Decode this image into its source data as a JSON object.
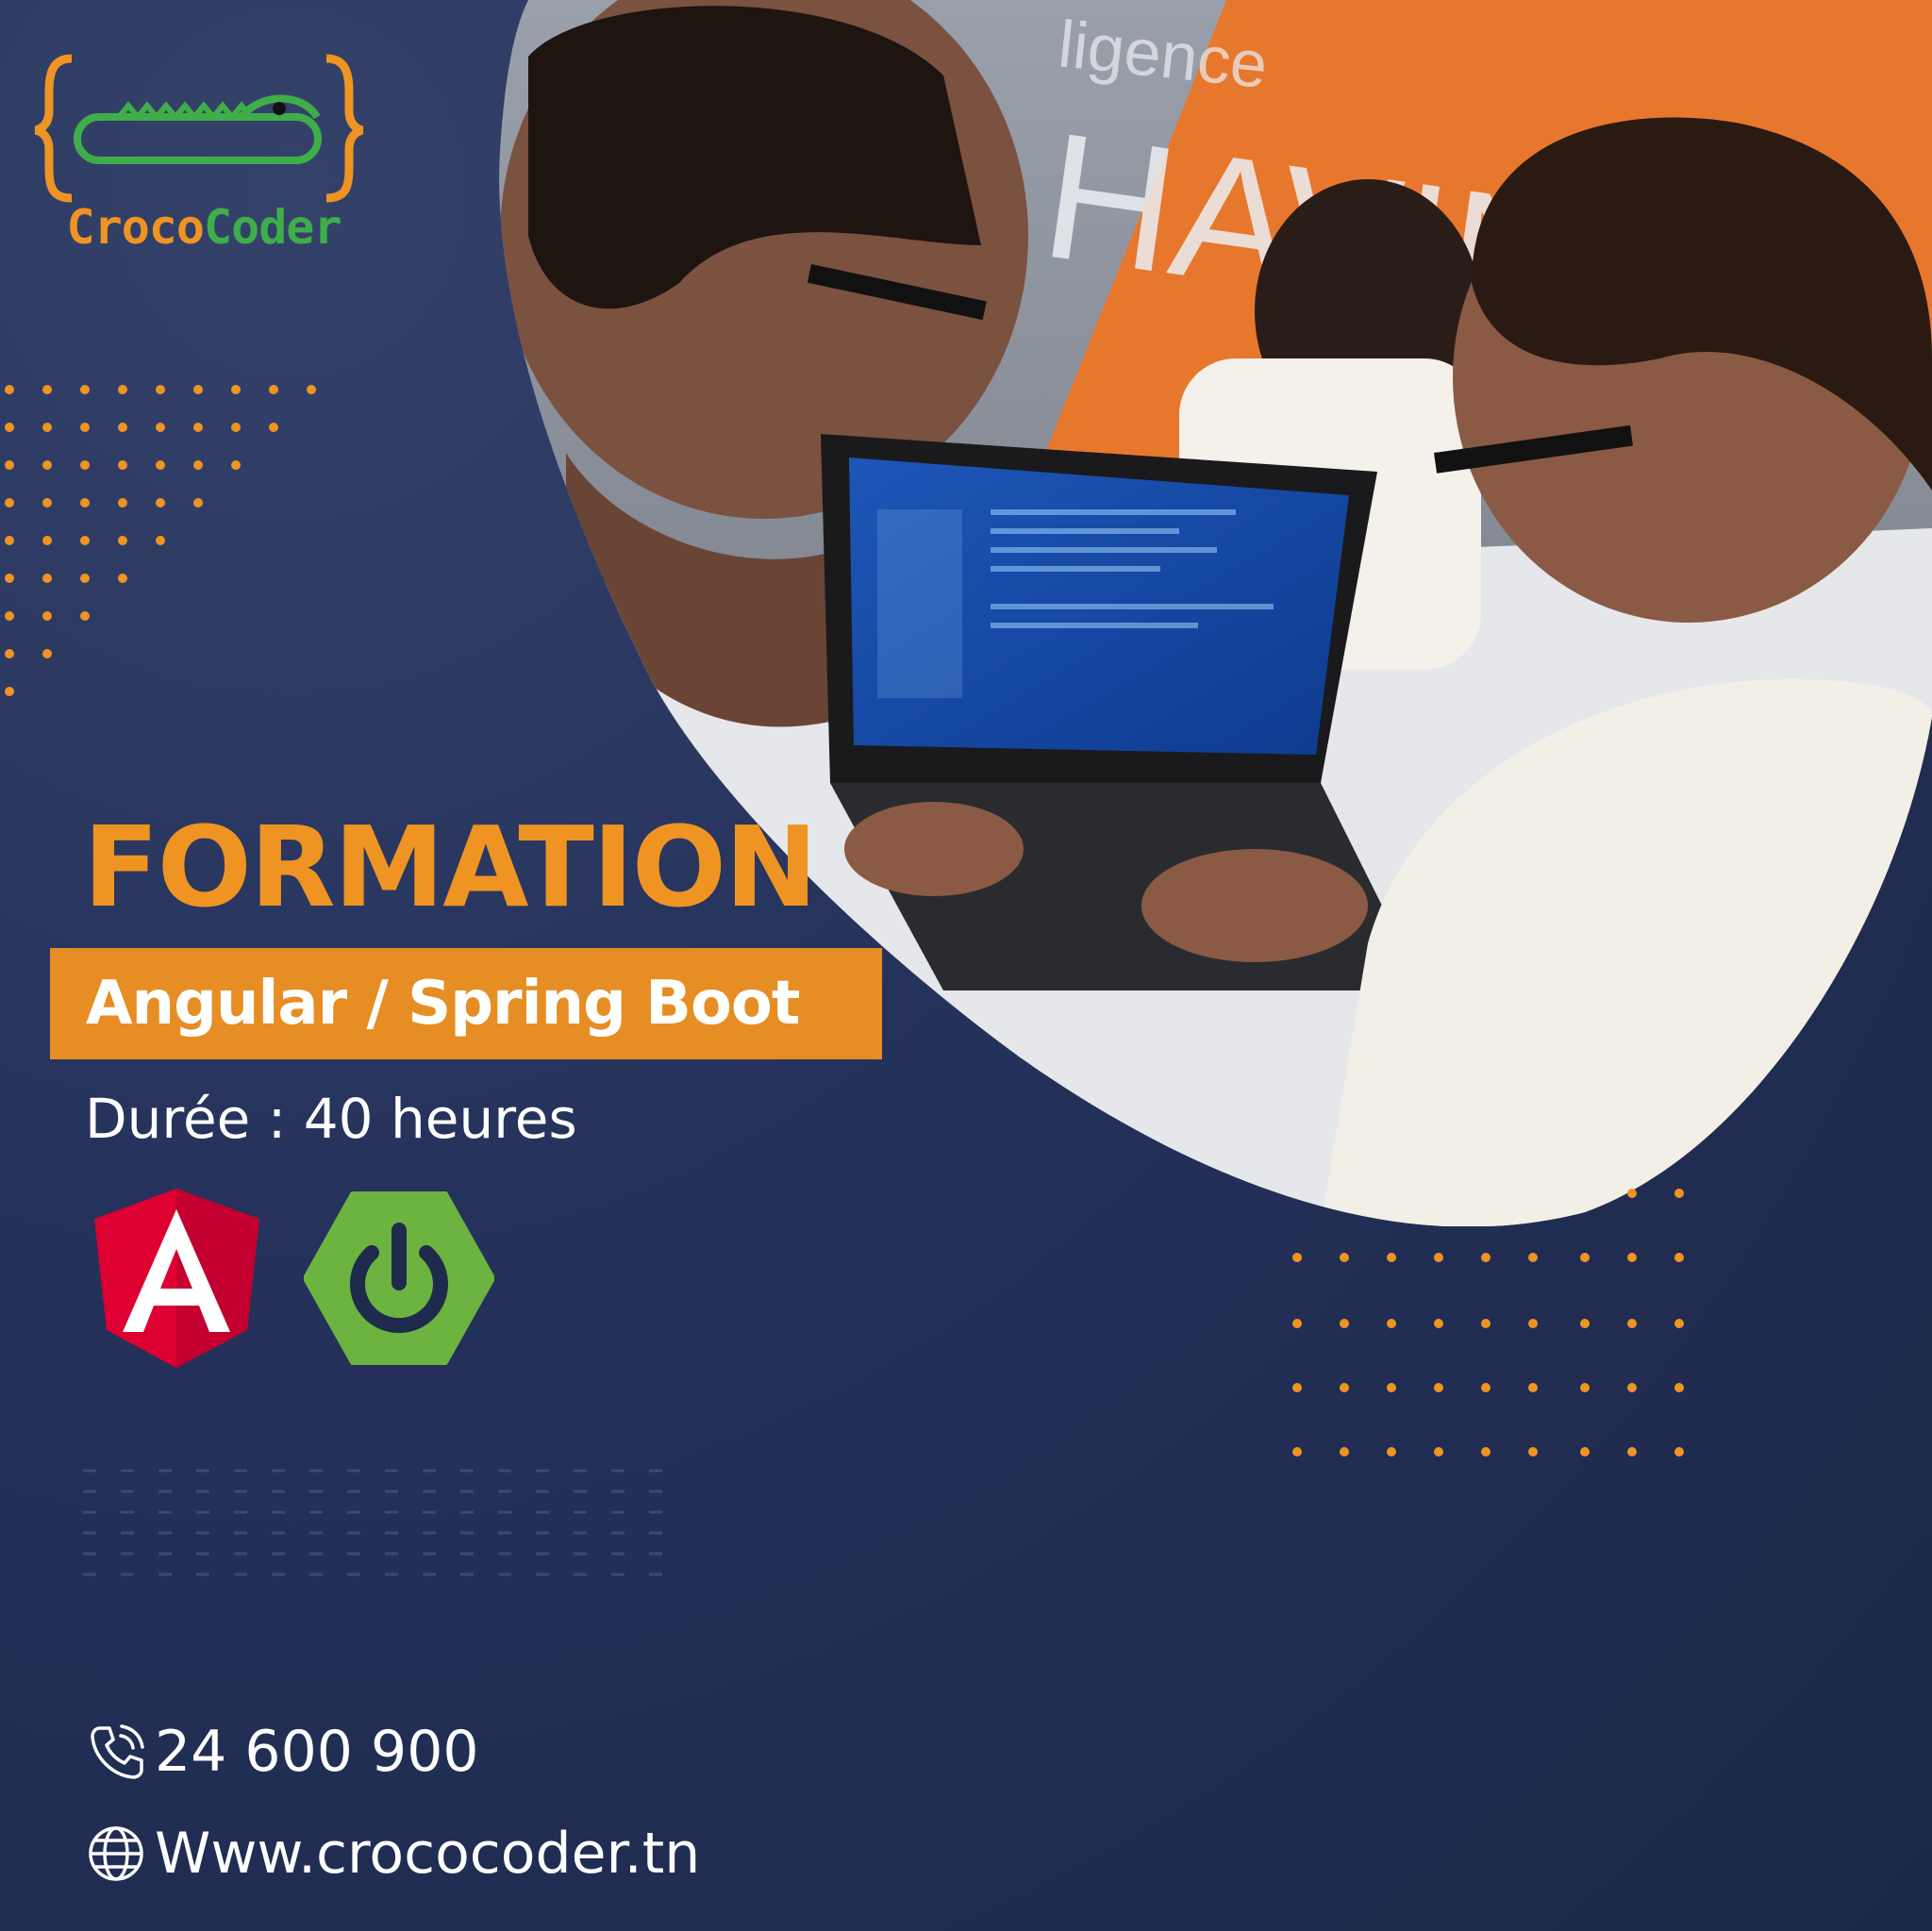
{
  "brand": {
    "name_part1": "Croco",
    "name_part2": "Coder",
    "color_orange": "#ef9422",
    "color_green": "#3fae49",
    "background": "#1f2b4d"
  },
  "headline": "FORMATION",
  "course_title": "Angular / Spring Boot",
  "duration": "Durée : 40 heures",
  "tech_logos": [
    {
      "name": "angular-icon",
      "letter": "A",
      "color": "#dd0031"
    },
    {
      "name": "spring-boot-icon",
      "color": "#6db33f"
    }
  ],
  "photo_wall_text": {
    "line1": "HAVING",
    "line2": "ligence"
  },
  "contact": {
    "phone_icon": "phone-icon",
    "phone": "24 600 900",
    "web_icon": "globe-icon",
    "website": "Www.crococoder.tn"
  }
}
